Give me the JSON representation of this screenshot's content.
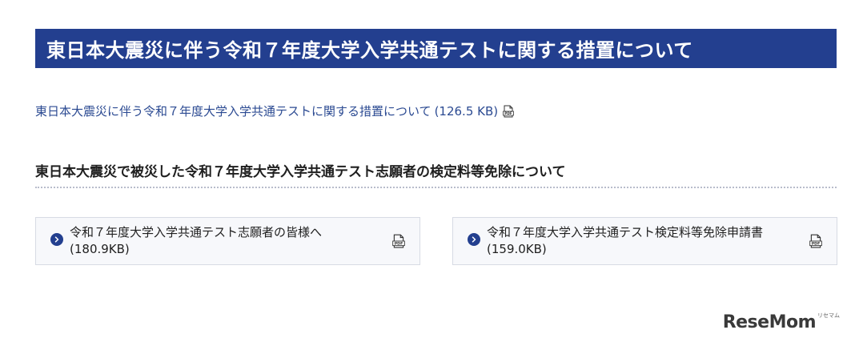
{
  "header": {
    "title": "東日本大震災に伴う令和７年度大学入学共通テストに関する措置について"
  },
  "document_link": {
    "label": "東日本大震災に伴う令和７年度大学入学共通テストに関する措置について",
    "size": "(126.5 KB)",
    "icon": "pdf-icon"
  },
  "section": {
    "heading": "東日本大震災で被災した令和７年度大学入学共通テスト志願者の検定料等免除について"
  },
  "cards": [
    {
      "label": "令和７年度大学入学共通テスト志願者の皆様へ",
      "size": "(180.9KB)",
      "icon": "pdf-icon"
    },
    {
      "label": "令和７年度大学入学共通テスト検定料等免除申請書",
      "size": "(159.0KB)",
      "icon": "pdf-icon"
    }
  ],
  "watermark": {
    "brand": "ReseMom",
    "sub": "リセマム"
  },
  "colors": {
    "primary": "#233f8f",
    "link": "#2b4a92",
    "card_bg": "#f7f8fb",
    "card_border": "#d7dbe4"
  }
}
